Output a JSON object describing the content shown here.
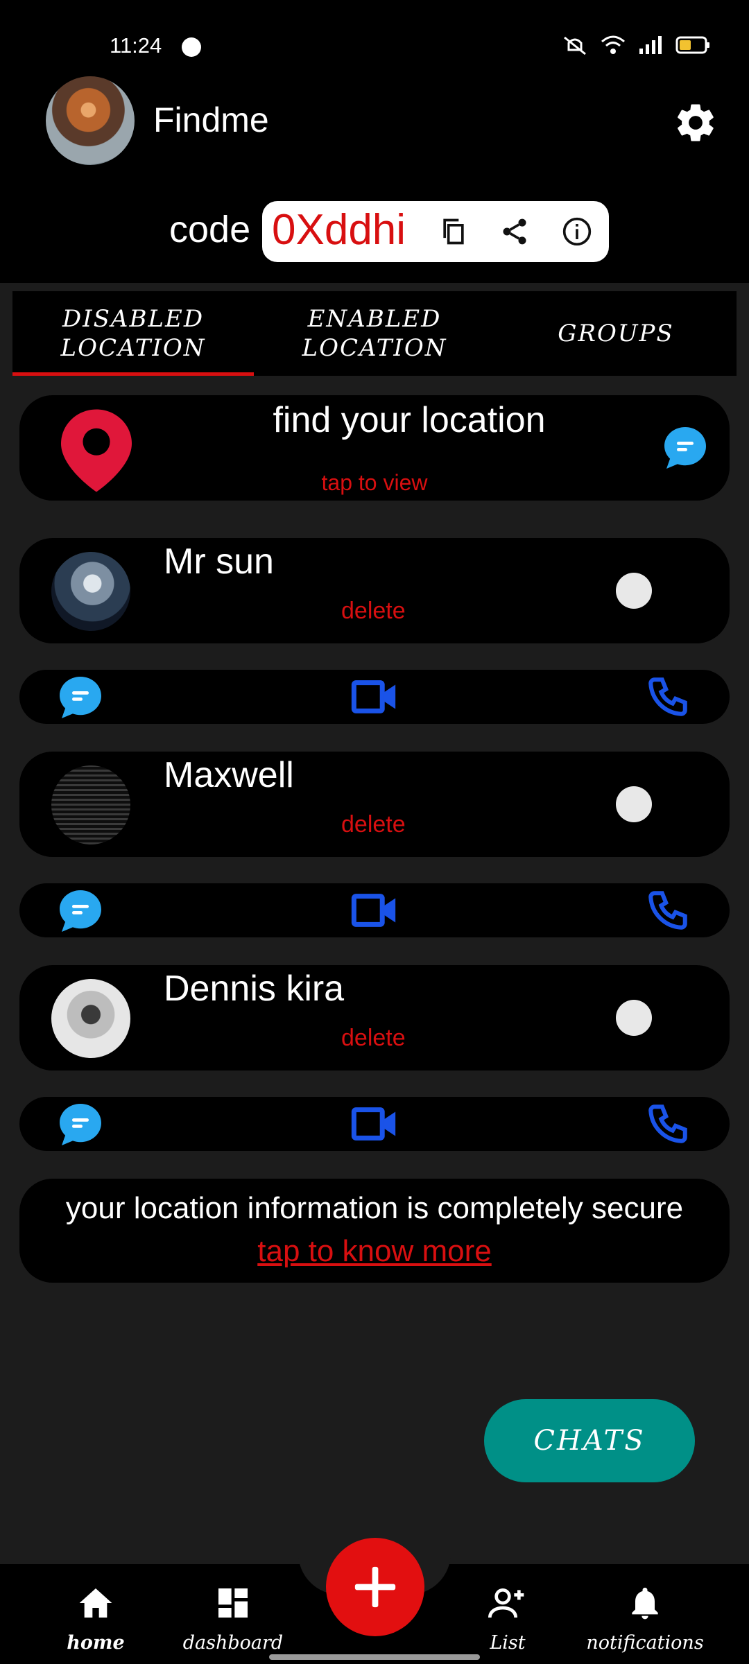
{
  "status_bar": {
    "time": "11:24"
  },
  "header": {
    "app_title": "Findme",
    "code_label": "code",
    "code_value": "0Xddhi"
  },
  "tabs": [
    {
      "label_line1": "DISABLED",
      "label_line2": "LOCATION",
      "active": true
    },
    {
      "label_line1": "ENABLED",
      "label_line2": "LOCATION",
      "active": false
    },
    {
      "label_line1": "GROUPS",
      "label_line2": "",
      "active": false
    }
  ],
  "find_location": {
    "title": "find your location",
    "subtitle": "tap to view"
  },
  "contacts": [
    {
      "name": "Mr sun",
      "delete_label": "delete"
    },
    {
      "name": "Maxwell",
      "delete_label": "delete"
    },
    {
      "name": "Dennis kira",
      "delete_label": "delete"
    }
  ],
  "secure_notice": {
    "text": "your location information is completely secure",
    "link": "tap to know more"
  },
  "chats_button": {
    "label": "CHATS"
  },
  "bottom_nav": [
    {
      "label": "home",
      "icon": "home-icon"
    },
    {
      "label": "dashboard",
      "icon": "dashboard-icon"
    },
    {
      "label": "List",
      "icon": "add-person-icon"
    },
    {
      "label": "notifications",
      "icon": "bell-icon"
    }
  ],
  "colors": {
    "accent_red": "#d80f10",
    "call_blue": "#1a53e8",
    "chat_blue": "#29a8f0",
    "teal": "#009087"
  }
}
